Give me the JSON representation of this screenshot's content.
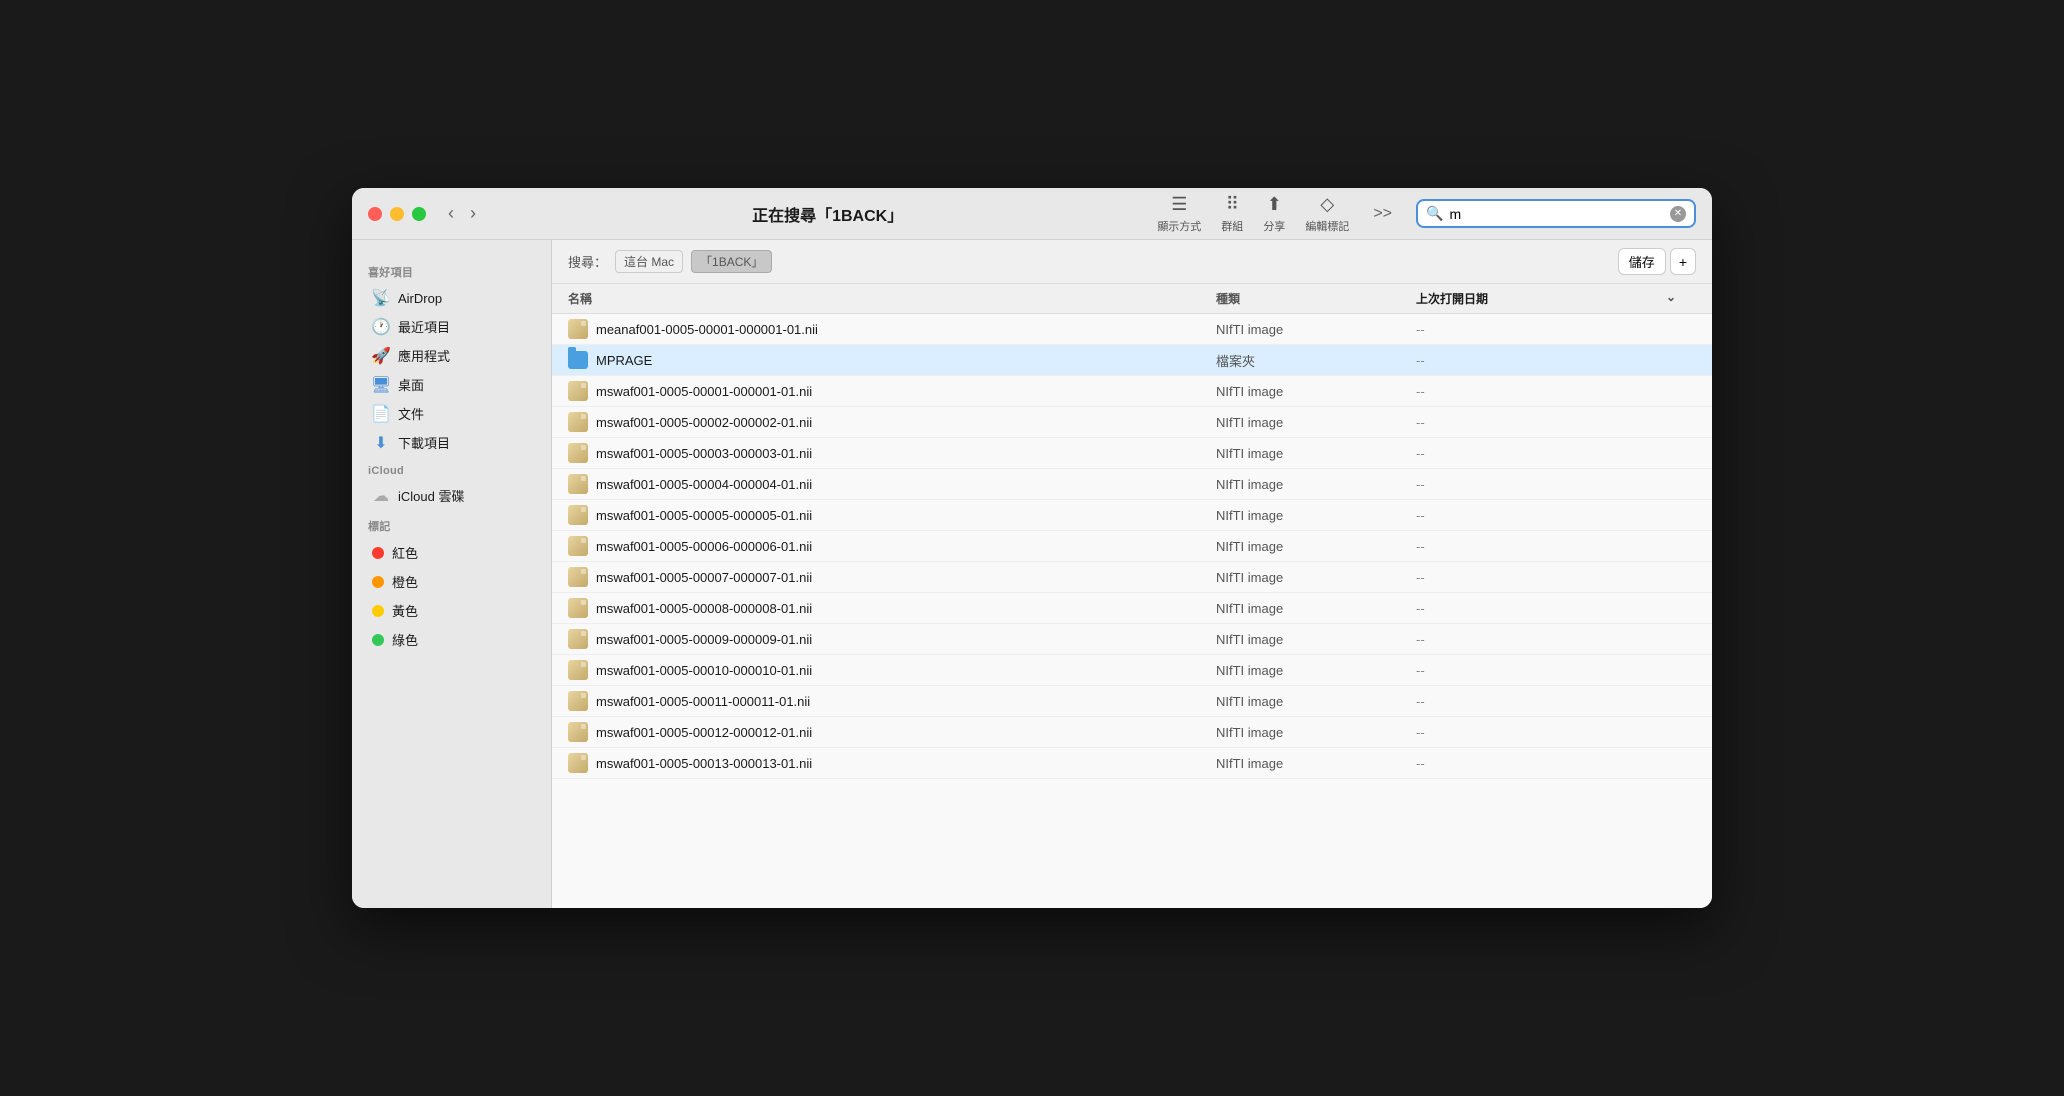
{
  "window": {
    "title": "正在搜尋「1BACK」"
  },
  "titlebar": {
    "back_label": "‹",
    "forward_label": "›",
    "nav_back": "返回/往前",
    "display_label": "顯示方式",
    "group_label": "群組",
    "share_label": "分享",
    "edit_tag_label": "編輯標記",
    "expand_label": ">>",
    "search_label": "搜尋",
    "search_value": "m"
  },
  "search_bar": {
    "search_prefix": "搜尋：",
    "scope_this_mac": "這台 Mac",
    "scope_1back": "「1BACK」",
    "save_label": "儲存",
    "plus_label": "+"
  },
  "table": {
    "col_name": "名稱",
    "col_type": "種類",
    "col_date": "上次打開日期",
    "rows": [
      {
        "name": "meanaf001-0005-00001-000001-01.nii",
        "type": "NIfTI image",
        "date": "--",
        "icon": "nifti"
      },
      {
        "name": "MPRAGE",
        "type": "檔案夾",
        "date": "--",
        "icon": "folder"
      },
      {
        "name": "mswaf001-0005-00001-000001-01.nii",
        "type": "NIfTI image",
        "date": "--",
        "icon": "nifti"
      },
      {
        "name": "mswaf001-0005-00002-000002-01.nii",
        "type": "NIfTI image",
        "date": "--",
        "icon": "nifti"
      },
      {
        "name": "mswaf001-0005-00003-000003-01.nii",
        "type": "NIfTI image",
        "date": "--",
        "icon": "nifti"
      },
      {
        "name": "mswaf001-0005-00004-000004-01.nii",
        "type": "NIfTI image",
        "date": "--",
        "icon": "nifti"
      },
      {
        "name": "mswaf001-0005-00005-000005-01.nii",
        "type": "NIfTI image",
        "date": "--",
        "icon": "nifti"
      },
      {
        "name": "mswaf001-0005-00006-000006-01.nii",
        "type": "NIfTI image",
        "date": "--",
        "icon": "nifti"
      },
      {
        "name": "mswaf001-0005-00007-000007-01.nii",
        "type": "NIfTI image",
        "date": "--",
        "icon": "nifti"
      },
      {
        "name": "mswaf001-0005-00008-000008-01.nii",
        "type": "NIfTI image",
        "date": "--",
        "icon": "nifti"
      },
      {
        "name": "mswaf001-0005-00009-000009-01.nii",
        "type": "NIfTI image",
        "date": "--",
        "icon": "nifti"
      },
      {
        "name": "mswaf001-0005-00010-000010-01.nii",
        "type": "NIfTI image",
        "date": "--",
        "icon": "nifti"
      },
      {
        "name": "mswaf001-0005-00011-000011-01.nii",
        "type": "NIfTI image",
        "date": "--",
        "icon": "nifti"
      },
      {
        "name": "mswaf001-0005-00012-000012-01.nii",
        "type": "NIfTI image",
        "date": "--",
        "icon": "nifti"
      },
      {
        "name": "mswaf001-0005-00013-000013-01.nii",
        "type": "NIfTI image",
        "date": "--",
        "icon": "nifti"
      }
    ]
  },
  "sidebar": {
    "favorites_label": "喜好項目",
    "icloud_label": "iCloud",
    "tags_label": "標記",
    "items": [
      {
        "id": "airdrop",
        "label": "AirDrop",
        "icon_type": "airdrop"
      },
      {
        "id": "recent",
        "label": "最近項目",
        "icon_type": "recent"
      },
      {
        "id": "apps",
        "label": "應用程式",
        "icon_type": "apps"
      },
      {
        "id": "desktop",
        "label": "桌面",
        "icon_type": "desktop"
      },
      {
        "id": "docs",
        "label": "文件",
        "icon_type": "docs"
      },
      {
        "id": "downloads",
        "label": "下載項目",
        "icon_type": "downloads"
      },
      {
        "id": "icloud",
        "label": "iCloud 雲碟",
        "icon_type": "icloud"
      }
    ],
    "tags": [
      {
        "id": "red",
        "label": "紅色",
        "color": "#ff3b30"
      },
      {
        "id": "orange",
        "label": "橙色",
        "color": "#ff9500"
      },
      {
        "id": "yellow",
        "label": "黃色",
        "color": "#ffcc00"
      },
      {
        "id": "green",
        "label": "綠色",
        "color": "#34c759"
      }
    ]
  }
}
